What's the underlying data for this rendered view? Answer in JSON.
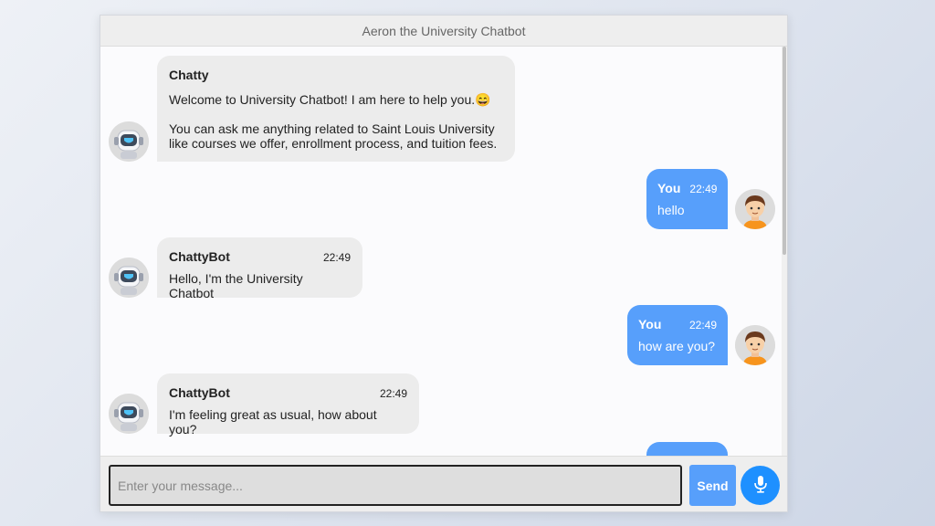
{
  "header": {
    "title": "Aeron the University Chatbot"
  },
  "messages": [
    {
      "sender": "Chatty",
      "time": "",
      "lines": [
        "Welcome to University Chatbot! I am here to help you."
      ],
      "emoji": "😄",
      "extra": [
        "You can ask me anything related to Saint Louis University",
        "like courses we offer, enrollment process, and tuition fees."
      ]
    },
    {
      "sender": "You",
      "time": "22:49",
      "text": "hello"
    },
    {
      "sender": "ChattyBot",
      "time": "22:49",
      "text": "Hello, I'm the University Chatbot"
    },
    {
      "sender": "You",
      "time": "22:49",
      "text": "how are you?"
    },
    {
      "sender": "ChattyBot",
      "time": "22:49",
      "text": "I'm feeling great as usual, how about you?"
    }
  ],
  "input": {
    "placeholder": "Enter your message...",
    "value": ""
  },
  "buttons": {
    "send_label": "Send",
    "mic_icon": "microphone-icon"
  },
  "icons": {
    "bot_avatar": "robot-avatar-icon",
    "user_avatar": "user-avatar-icon"
  },
  "colors": {
    "user_bubble": "#579ffb",
    "bot_bubble": "#ececec",
    "mic_button": "#1e90ff",
    "header_bg": "#eeeeee"
  }
}
